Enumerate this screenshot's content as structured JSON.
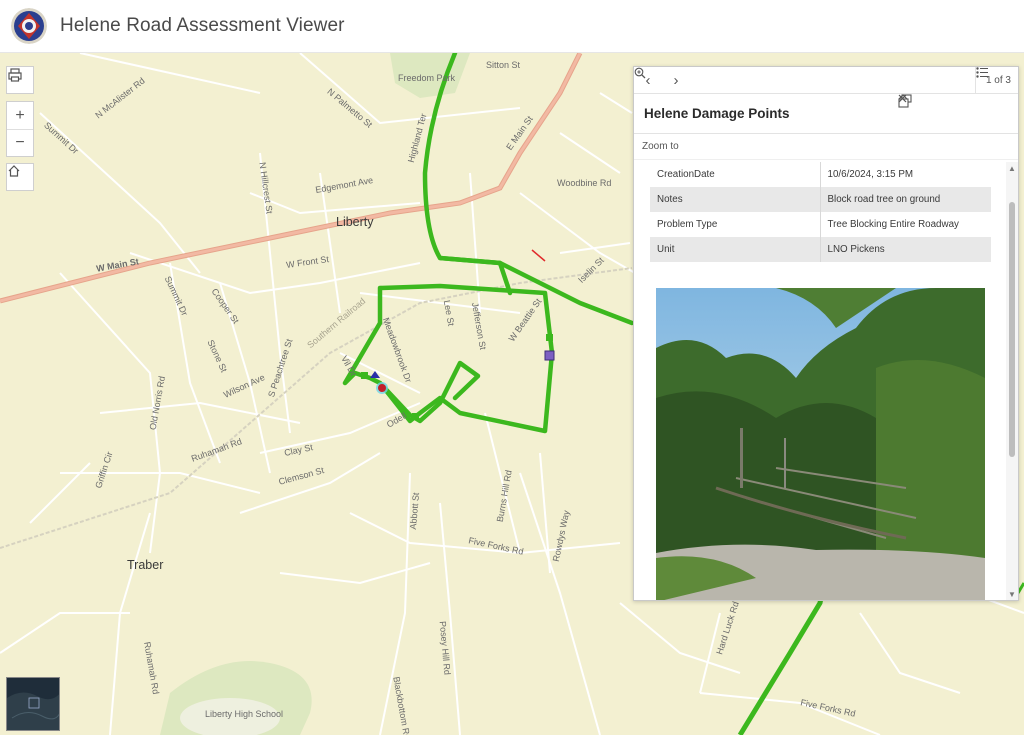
{
  "app": {
    "title": "Helene Road Assessment Viewer"
  },
  "map": {
    "place_labels": {
      "liberty": "Liberty",
      "traber": "Traber"
    },
    "street_labels": {
      "freedom_park": "Freedom Park",
      "sitton_st": "Sitton St",
      "n_mcalister_rd": "N McAlister Rd",
      "n_palmetto_st": "N Palmetto St",
      "highland_ter": "Highland Ter",
      "e_main_st": "E Main St",
      "summit_dr": "Summit Dr",
      "n_hillcrest_st": "N Hillcrest St",
      "edgemont_ave": "Edgemont Ave",
      "woodbine_rd": "Woodbine Rd",
      "w_main_st": "W Main St",
      "w_front_st": "W Front St",
      "cooper_st": "Cooper St",
      "summit_dr_2": "Summit Dr",
      "southern_railroad": "Southern Railroad",
      "lee_st": "Lee St",
      "jefferson_st": "Jefferson St",
      "w_beattie_st": "W Beattie St",
      "iselin_st": "Iselin St",
      "meadowbrook_dr": "Meadowbrook Dr",
      "stone_st": "Stone St",
      "wilson_ave": "Wilson Ave",
      "s_peachtree_st": "S Peachtree St",
      "old_norris_rd": "Old Norris Rd",
      "clay_st": "Clay St",
      "clemson_st": "Clemson St",
      "griffin_cir": "Griffin Cir",
      "ruhamah_rd": "Ruhamah Rd",
      "abbott_st": "Abbott St",
      "burns_hill_rd": "Burns Hill Rd",
      "rowdys_way": "Rowdys Way",
      "five_forks_rd": "Five Forks Rd",
      "posey_hill_rd": "Posey Hill Rd",
      "ruhamah_rd_2": "Ruhamah Rd",
      "blackbottom_rd": "Blackbottom Rd",
      "hard_luck_rd": "Hard Luck Rd",
      "five_forks_rd_2": "Five Forks Rd",
      "liberty_high": "Liberty High School",
      "odell": "Odell",
      "vil_dr": "Vil Dr"
    }
  },
  "popup": {
    "nav_count": "1 of 3",
    "title": "Helene Damage Points",
    "zoom_to": "Zoom to",
    "attributes": [
      {
        "key": "CreationDate",
        "value": "10/6/2024, 3:15 PM"
      },
      {
        "key": "Notes",
        "value": "Block road tree on ground"
      },
      {
        "key": "Problem Type",
        "value": "Tree Blocking Entire Roadway"
      },
      {
        "key": "Unit",
        "value": "LNO Pickens"
      }
    ]
  },
  "colors": {
    "map_bg": "#f3f0d1",
    "road_major": "#eaa98f",
    "route_green": "#3cb81e",
    "header_bg": "#ffffff"
  },
  "icons": {
    "print": "printer-icon",
    "zoom_in": "plus-icon",
    "zoom_out": "minus-icon",
    "home": "home-icon",
    "prev": "chevron-left-icon",
    "next": "chevron-right-icon",
    "list": "list-icon",
    "dock": "dock-icon",
    "collapse": "chevron-up-icon",
    "close": "close-icon",
    "zoom_to": "magnifier-plus-icon"
  }
}
